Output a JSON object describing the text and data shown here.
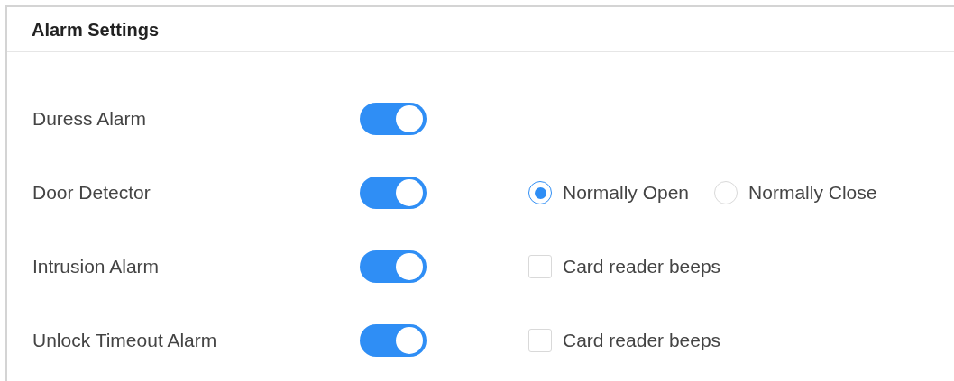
{
  "panel": {
    "title": "Alarm Settings"
  },
  "rows": [
    {
      "label": "Duress Alarm",
      "on": true
    },
    {
      "label": "Door Detector",
      "on": true,
      "extra": {
        "kind": "radio",
        "options": [
          {
            "label": "Normally Open",
            "selected": true
          },
          {
            "label": "Normally Close",
            "selected": false
          }
        ]
      }
    },
    {
      "label": "Intrusion Alarm",
      "on": true,
      "extra": {
        "kind": "checkbox",
        "label": "Card reader beeps",
        "checked": false
      }
    },
    {
      "label": "Unlock Timeout Alarm",
      "on": true,
      "extra": {
        "kind": "checkbox",
        "label": "Card reader beeps",
        "checked": false
      }
    }
  ]
}
